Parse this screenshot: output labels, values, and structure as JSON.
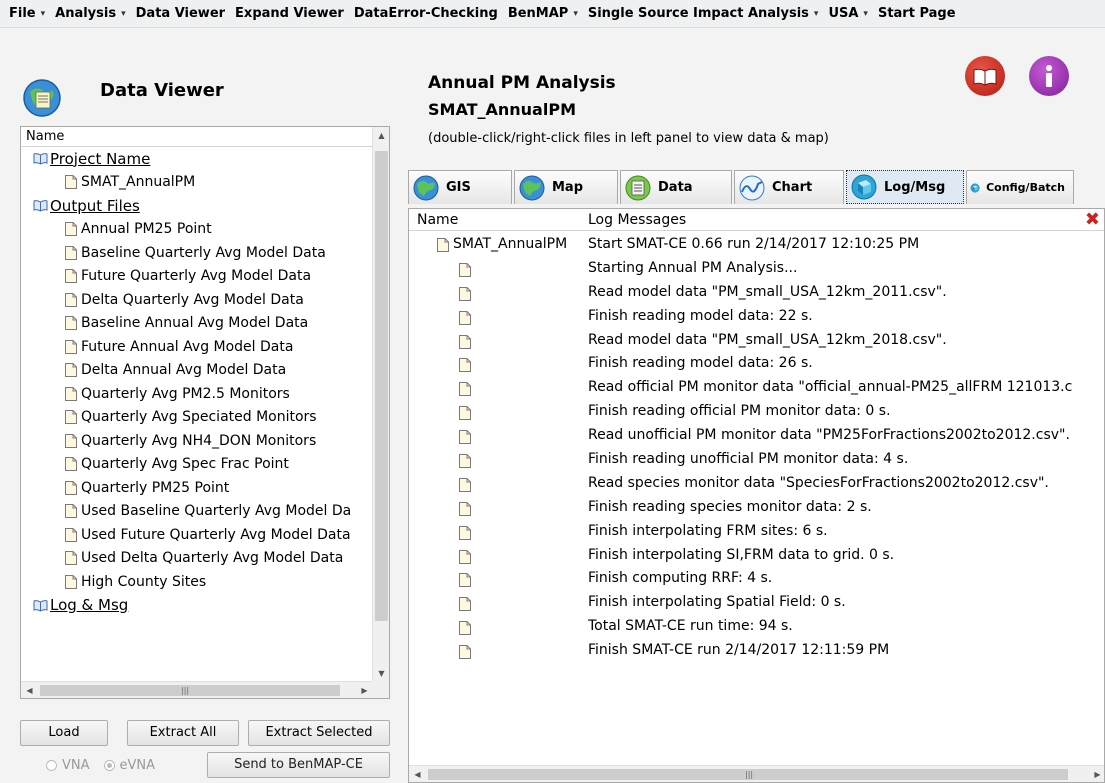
{
  "menu": [
    {
      "label": "File",
      "dropdown": true
    },
    {
      "label": "Analysis",
      "dropdown": true
    },
    {
      "label": "Data Viewer",
      "dropdown": false
    },
    {
      "label": "Expand Viewer",
      "dropdown": false
    },
    {
      "label": "DataError-Checking",
      "dropdown": false
    },
    {
      "label": "BenMAP",
      "dropdown": true
    },
    {
      "label": "Single Source Impact Analysis",
      "dropdown": true
    },
    {
      "label": "USA",
      "dropdown": true
    },
    {
      "label": "Start Page",
      "dropdown": false
    }
  ],
  "data_viewer": {
    "title": "Data Viewer",
    "column_header": "Name",
    "tree": [
      {
        "label": "Project Name",
        "group": true
      },
      {
        "label": "SMAT_AnnualPM",
        "group": false
      },
      {
        "label": "Output Files",
        "group": true
      },
      {
        "label": "Annual PM25 Point",
        "group": false
      },
      {
        "label": "Baseline Quarterly Avg Model Data",
        "group": false
      },
      {
        "label": "Future Quarterly Avg Model Data",
        "group": false
      },
      {
        "label": "Delta Quarterly Avg Model Data",
        "group": false
      },
      {
        "label": "Baseline Annual Avg Model Data",
        "group": false
      },
      {
        "label": "Future Annual Avg Model Data",
        "group": false
      },
      {
        "label": "Delta Annual Avg Model Data",
        "group": false
      },
      {
        "label": "Quarterly Avg PM2.5 Monitors",
        "group": false
      },
      {
        "label": "Quarterly Avg Speciated Monitors",
        "group": false
      },
      {
        "label": "Quarterly Avg NH4_DON Monitors",
        "group": false
      },
      {
        "label": "Quarterly Avg Spec Frac Point",
        "group": false
      },
      {
        "label": "Quarterly PM25 Point",
        "group": false
      },
      {
        "label": "Used Baseline Quarterly Avg Model Da",
        "group": false
      },
      {
        "label": "Used Future Quarterly Avg Model Data",
        "group": false
      },
      {
        "label": "Used Delta Quarterly Avg Model Data",
        "group": false
      },
      {
        "label": "High County Sites",
        "group": false
      },
      {
        "label": "Log & Msg",
        "group": true
      }
    ],
    "buttons": {
      "load": "Load",
      "extract_all": "Extract All",
      "extract_selected": "Extract Selected",
      "send": "Send to BenMAP-CE"
    },
    "radios": [
      {
        "label": "VNA",
        "checked": false
      },
      {
        "label": "eVNA",
        "checked": true
      }
    ]
  },
  "analysis": {
    "title": "Annual PM Analysis",
    "subtitle": "SMAT_AnnualPM",
    "hint": "(double-click/right-click files in left panel to view data & map)"
  },
  "tabs": [
    {
      "label": "GIS",
      "icon": "globe-icon",
      "active": false
    },
    {
      "label": "Map",
      "icon": "globe-icon",
      "active": false
    },
    {
      "label": "Data",
      "icon": "data-sheet-icon",
      "active": false
    },
    {
      "label": "Chart",
      "icon": "chart-wave-icon",
      "active": false
    },
    {
      "label": "Log/Msg",
      "icon": "log-cube-icon",
      "active": true
    },
    {
      "label": "Config/Batch",
      "icon": "config-cube-icon",
      "active": false
    }
  ],
  "log": {
    "col_name": "Name",
    "col_messages": "Log Messages",
    "rows": [
      {
        "name": "SMAT_AnnualPM",
        "message": "Start SMAT-CE 0.66 run        2/14/2017 12:10:25 PM"
      },
      {
        "name": "",
        "message": "Starting Annual PM Analysis..."
      },
      {
        "name": "",
        "message": "Read model data \"PM_small_USA_12km_2011.csv\"."
      },
      {
        "name": "",
        "message": "Finish reading model data: 22 s."
      },
      {
        "name": "",
        "message": "Read model data \"PM_small_USA_12km_2018.csv\"."
      },
      {
        "name": "",
        "message": "Finish reading model data: 26 s."
      },
      {
        "name": "",
        "message": "Read official PM monitor data \"official_annual-PM25_allFRM 121013.c"
      },
      {
        "name": "",
        "message": "Finish reading official PM monitor data: 0 s."
      },
      {
        "name": "",
        "message": "Read unofficial PM monitor data \"PM25ForFractions2002to2012.csv\"."
      },
      {
        "name": "",
        "message": "Finish reading unofficial PM monitor data: 4 s."
      },
      {
        "name": "",
        "message": "Read species monitor data \"SpeciesForFractions2002to2012.csv\"."
      },
      {
        "name": "",
        "message": "Finish reading species monitor data: 2 s."
      },
      {
        "name": "",
        "message": "Finish interpolating FRM sites: 6 s."
      },
      {
        "name": "",
        "message": "Finish interpolating SI,FRM data to grid. 0 s."
      },
      {
        "name": "",
        "message": "Finish computing RRF: 4 s."
      },
      {
        "name": "",
        "message": "Finish interpolating Spatial Field: 0 s."
      },
      {
        "name": "",
        "message": "Total SMAT-CE run time: 94 s."
      },
      {
        "name": "",
        "message": "Finish SMAT-CE run        2/14/2017 12:11:59 PM"
      }
    ]
  },
  "colors": {
    "close": "#d02020",
    "book_icon": "#c0281b",
    "info_icon": "#9a2fb5",
    "active_tab": "#dfe9f3"
  }
}
